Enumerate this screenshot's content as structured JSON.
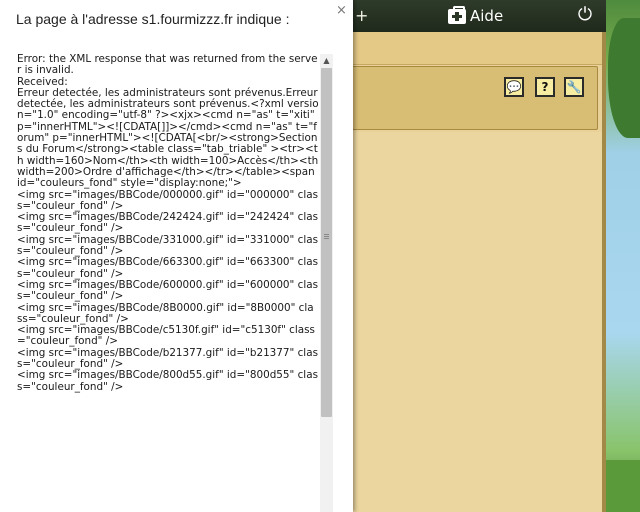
{
  "game": {
    "topbar": {
      "plus_label": "+",
      "help_label": "Aide",
      "power_glyph": "⏻"
    },
    "panel_tools": {
      "chat_glyph": "💬",
      "help_glyph": "?",
      "settings_glyph": "🔧"
    }
  },
  "alert": {
    "title": "La page à l'adresse s1.fourmizzz.fr indique :",
    "close_glyph": "×",
    "message": "Error: the XML response that was returned from the server is invalid.\nReceived:\nErreur detectée, les administrateurs sont prévenus.Erreur detectée, les administrateurs sont prévenus.<?xml version=\"1.0\" encoding=\"utf-8\" ?><xjx><cmd n=\"as\" t=\"xiti\" p=\"innerHTML\"><![CDATA[]]></cmd><cmd n=\"as\" t=\"forum\" p=\"innerHTML\"><![CDATA[<br/><strong>Sections du Forum</strong><table class=\"tab_triable\" ><tr><th width=160>Nom</th><th width=100>Accès</th><th width=200>Ordre d'affichage</th></tr></table><span id=\"couleurs_fond\" style=\"display:none;\">\n<img src=\"images/BBCode/000000.gif\" id=\"000000\" class=\"couleur_fond\" />\n<img src=\"images/BBCode/242424.gif\" id=\"242424\" class=\"couleur_fond\" />\n<img src=\"images/BBCode/331000.gif\" id=\"331000\" class=\"couleur_fond\" />\n<img src=\"images/BBCode/663300.gif\" id=\"663300\" class=\"couleur_fond\" />\n<img src=\"images/BBCode/600000.gif\" id=\"600000\" class=\"couleur_fond\" />\n<img src=\"images/BBCode/8B0000.gif\" id=\"8B0000\" class=\"couleur_fond\" />\n<img src=\"images/BBCode/c5130f.gif\" id=\"c5130f\" class=\"couleur_fond\" />\n<img src=\"images/BBCode/b21377.gif\" id=\"b21377\" class=\"couleur_fond\" />\n<img src=\"images/BBCode/800d55.gif\" id=\"800d55\" class=\"couleur_fond\" />",
    "scroll_up_glyph": "▲"
  }
}
